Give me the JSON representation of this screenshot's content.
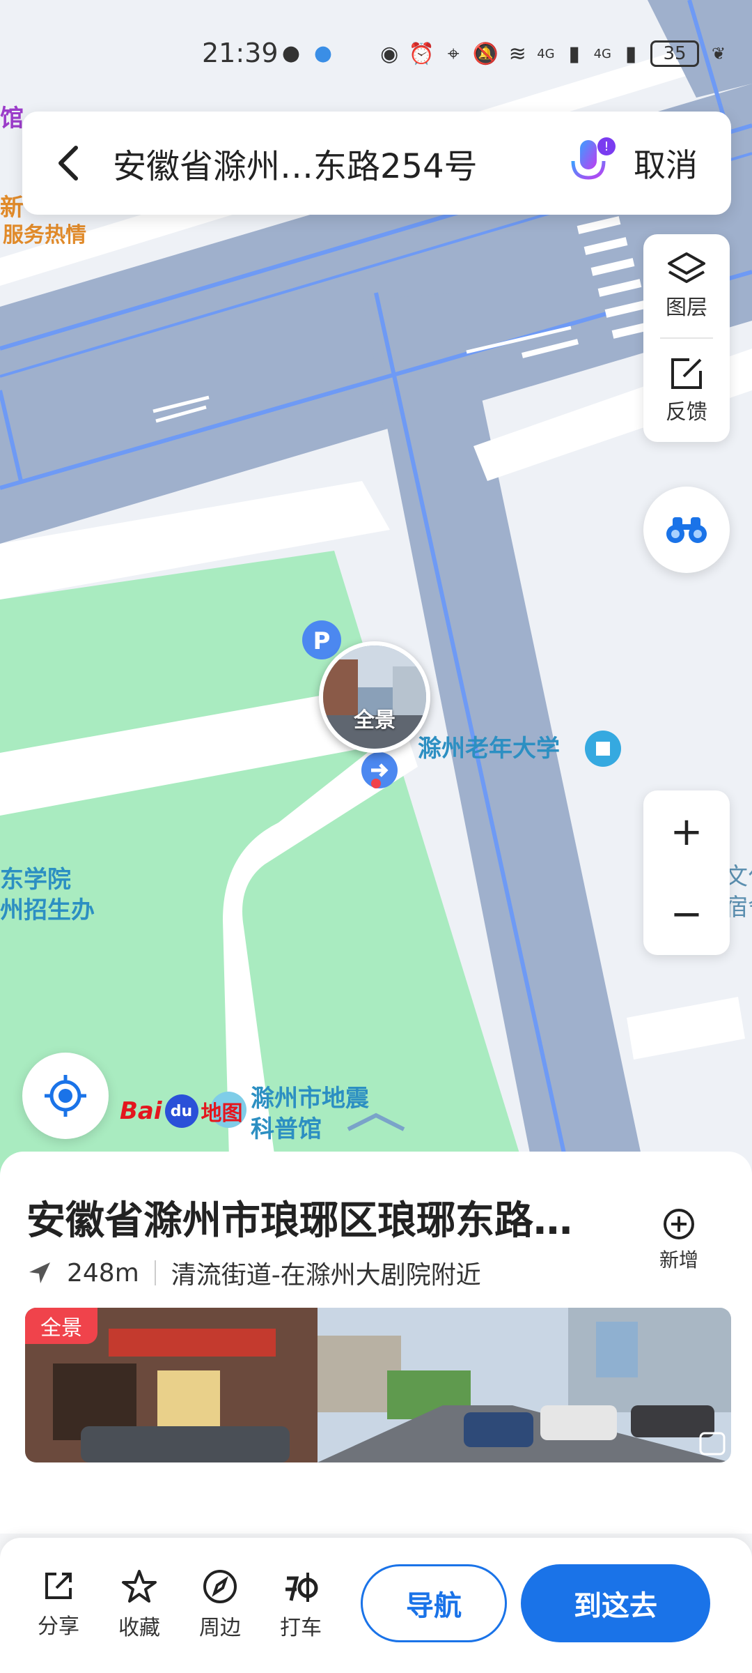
{
  "status": {
    "time": "21:39",
    "network_4g_a": "4G",
    "network_4g_b": "4G",
    "battery": "35"
  },
  "search": {
    "query": "安徽省滁州…东路254号",
    "cancel_label": "取消"
  },
  "side": {
    "layers_label": "图层",
    "feedback_label": "反馈"
  },
  "zoom": {
    "in_label": "+",
    "out_label": "−"
  },
  "map_labels": {
    "top_left_poi": "馆",
    "top_left_line1": "新",
    "top_left_line2": "服务热情",
    "university": "滁州老年大学",
    "left_line1": "东学院",
    "left_line2": "州招生办",
    "right_line1": "文化",
    "right_line2": "宿舍",
    "museum_line1": "滁州市地震",
    "museum_line2": "科普馆",
    "pano_pin": "全景",
    "parking": "P"
  },
  "logo": {
    "bai": "Bai",
    "du": "du",
    "map": "地图"
  },
  "place": {
    "title": "安徽省滁州市琅琊区琅琊东路…",
    "distance": "248m",
    "address": "清流街道-在滁州大剧院附近",
    "add_label": "新增",
    "pano_badge": "全景"
  },
  "actions": {
    "share": "分享",
    "favorite": "收藏",
    "nearby": "周边",
    "taxi": "打车",
    "navigate": "导航",
    "go_here": "到这去"
  },
  "colors": {
    "accent": "#1a73e8",
    "road": "#9fb0cc",
    "road_edge": "#6e9af5",
    "green": "#a9ebc0",
    "badge_red": "#f0434b"
  }
}
